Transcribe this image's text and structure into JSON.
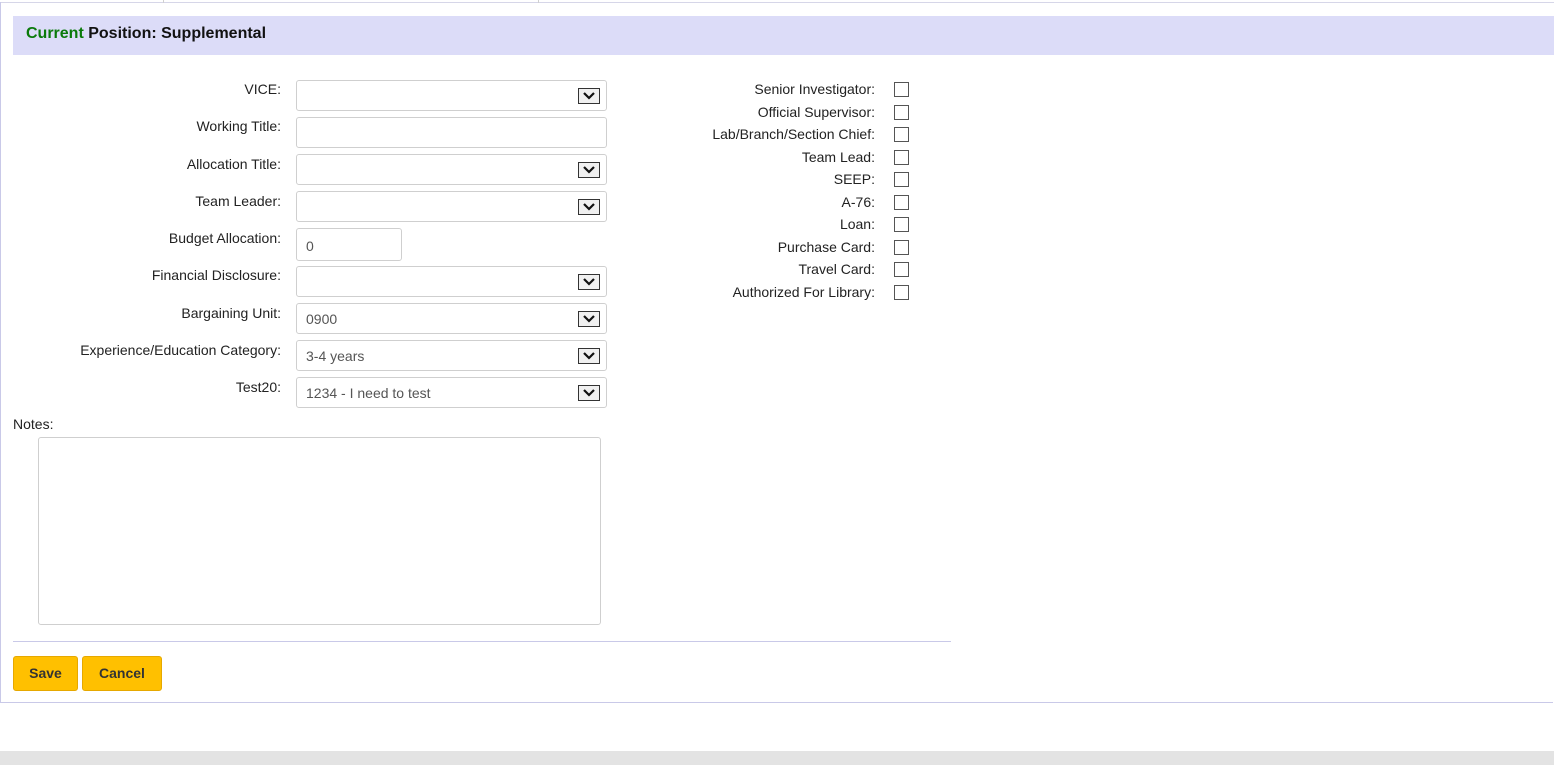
{
  "header": {
    "title_accent": "Current",
    "title_rest": " Position: Supplemental"
  },
  "form": {
    "fields": [
      {
        "label": "VICE:",
        "value": "",
        "type": "select"
      },
      {
        "label": "Working Title:",
        "value": "",
        "type": "text"
      },
      {
        "label": "Allocation Title:",
        "value": "",
        "type": "select"
      },
      {
        "label": "Team Leader:",
        "value": "",
        "type": "select"
      },
      {
        "label": "Budget Allocation:",
        "value": "0",
        "type": "text"
      },
      {
        "label": "Financial Disclosure:",
        "value": "",
        "type": "select"
      },
      {
        "label": "Bargaining Unit:",
        "value": "0900",
        "type": "select"
      },
      {
        "label": "Experience/Education Category:",
        "value": "3-4 years",
        "type": "select"
      },
      {
        "label": "Test20:",
        "value": "1234 - I need to test",
        "type": "select"
      }
    ],
    "checkboxes": [
      {
        "label": "Senior Investigator:",
        "checked": false
      },
      {
        "label": "Official Supervisor:",
        "checked": false
      },
      {
        "label": "Lab/Branch/Section Chief:",
        "checked": false
      },
      {
        "label": "Team Lead:",
        "checked": false
      },
      {
        "label": "SEEP:",
        "checked": false
      },
      {
        "label": "A-76:",
        "checked": false
      },
      {
        "label": "Loan:",
        "checked": false
      },
      {
        "label": "Purchase Card:",
        "checked": false
      },
      {
        "label": "Travel Card:",
        "checked": false
      },
      {
        "label": "Authorized For Library:",
        "checked": false
      }
    ],
    "notes_label": "Notes:",
    "notes_value": ""
  },
  "buttons": {
    "save": "Save",
    "cancel": "Cancel"
  },
  "colors": {
    "header_bg": "#dcdcf8",
    "accent_green": "#0a7a0a",
    "button_bg": "#ffc000"
  }
}
